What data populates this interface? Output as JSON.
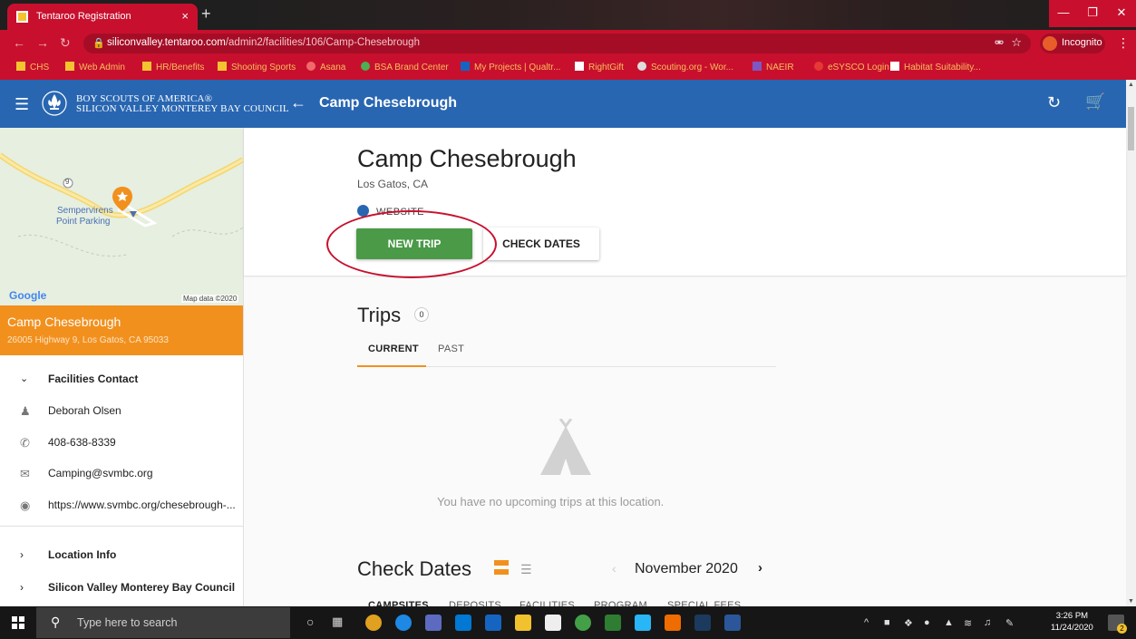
{
  "browser": {
    "tab_title": "Tentaroo Registration",
    "tab_close": "×",
    "new_tab": "+",
    "url_host": "siliconvalley.tentaroo.com",
    "url_path": "/admin2/facilities/106/Camp-Chesebrough",
    "profile_label": "Incognito",
    "bookmarks": [
      "CHS",
      "Web Admin",
      "HR/Benefits",
      "Shooting Sports",
      "Asana",
      "BSA Brand Center",
      "My Projects | Qualtr...",
      "RightGift",
      "Scouting.org - Wor...",
      "NAEIR",
      "eSYSCO Login",
      "Habitat Suitability..."
    ],
    "accent_color": "#c8102e"
  },
  "header": {
    "org_line1": "BOY SCOUTS OF AMERICA®",
    "org_line2": "SILICON VALLEY MONTEREY BAY COUNCIL",
    "title": "Camp Chesebrough",
    "brand_color": "#2866b1"
  },
  "map": {
    "place_label_1": "Sempervirens",
    "place_label_2": "Point Parking",
    "road_label": "9",
    "google_label": "Google",
    "credit": "Map data ©2020"
  },
  "facility_card": {
    "name": "Camp Chesebrough",
    "address": "26005 Highway 9, Los Gatos, CA 95033",
    "color": "#f2901e"
  },
  "contact": {
    "section_title": "Facilities Contact",
    "name": "Deborah Olsen",
    "phone": "408-638-8339",
    "email": "Camping@svmbc.org",
    "website": "https://www.svmbc.org/chesebrough-..."
  },
  "sections": {
    "location_info": "Location Info",
    "council": "Silicon Valley Monterey Bay Council"
  },
  "main": {
    "title": "Camp Chesebrough",
    "location": "Los Gatos, CA",
    "website_label": "WEBSITE",
    "new_trip_label": "NEW TRIP",
    "check_dates_label": "CHECK DATES",
    "trips_title": "Trips",
    "trips_count": "0",
    "tabs": [
      "CURRENT",
      "PAST"
    ],
    "empty_message": "You have no upcoming trips at this location.",
    "check_dates_title": "Check Dates",
    "month": "November 2020",
    "date_tabs": [
      "CAMPSITES",
      "DEPOSITS",
      "FACILITIES",
      "PROGRAM",
      "SPECIAL FEES"
    ],
    "primary_color": "#4a9a48"
  },
  "taskbar": {
    "search_placeholder": "Type here to search",
    "time": "3:26 PM",
    "date": "11/24/2020",
    "notification_count": "2"
  }
}
